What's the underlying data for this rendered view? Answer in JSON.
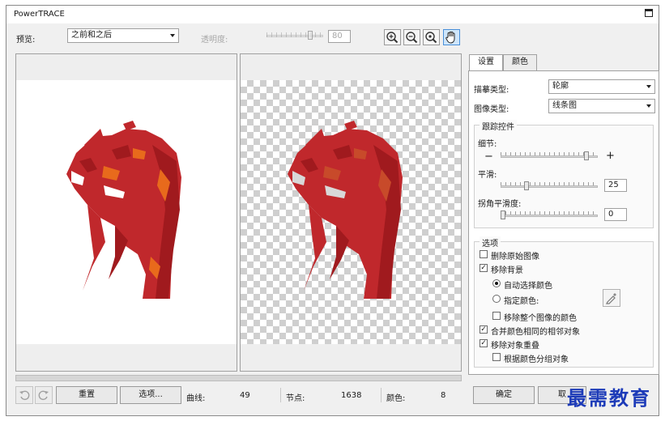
{
  "window": {
    "title": "PowerTRACE"
  },
  "toolbar": {
    "preview_label": "预览:",
    "preview_value": "之前和之后",
    "transparency_label": "透明度:",
    "transparency_value": "80",
    "transparency_level": 0.8
  },
  "tabs": [
    {
      "label": "设置"
    },
    {
      "label": "颜色"
    }
  ],
  "settings": {
    "trace_type_label": "描摹类型:",
    "trace_type_value": "轮廓",
    "image_type_label": "图像类型:",
    "image_type_value": "线条图",
    "trace_controls_title": "跟踪控件",
    "detail_label": "细节:",
    "detail_level": 0.9,
    "smoothing_label": "平滑:",
    "smoothing_value": "25",
    "corner_label": "拐角平滑度:",
    "corner_value": "0"
  },
  "options": {
    "title": "选项",
    "delete_original": "删除原始图像",
    "remove_background": "移除背景",
    "auto_color": "自动选择颜色",
    "specify_color": "指定颜色:",
    "remove_whole_color": "移除整个图像的颜色",
    "merge_adjacent": "合并颜色相同的相邻对象",
    "remove_overlap": "移除对象重叠",
    "group_by_color": "根据颜色分组对象"
  },
  "footer": {
    "reset_label": "重置",
    "options_label": "选项...",
    "curves_label": "曲线:",
    "curves_value": "49",
    "nodes_label": "节点:",
    "nodes_value": "1638",
    "colors_label": "颜色:",
    "colors_value": "8",
    "ok_label": "确定",
    "cancel_label": "取"
  },
  "watermark": "最需教育",
  "colors": {
    "fist_dark": "#a01a1e",
    "fist_main": "#c0282c",
    "fist_orange": "#e86a1c"
  }
}
